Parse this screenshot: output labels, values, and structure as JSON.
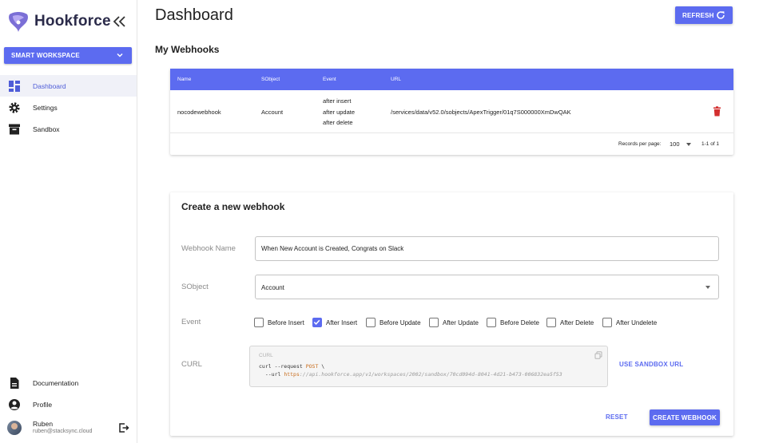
{
  "app": {
    "name": "Hookforce",
    "brand_color": "#5c6bf0"
  },
  "sidebar": {
    "workspace_label": "SMART WORKSPACE",
    "nav": [
      {
        "label": "Dashboard",
        "icon": "dashboard-icon",
        "active": true
      },
      {
        "label": "Settings",
        "icon": "gear-icon",
        "active": false
      },
      {
        "label": "Sandbox",
        "icon": "archive-box-icon",
        "active": false
      }
    ],
    "bottom_nav": [
      {
        "label": "Documentation",
        "icon": "document-icon"
      },
      {
        "label": "Profile",
        "icon": "account-circle-icon"
      }
    ],
    "user": {
      "name": "Ruben",
      "email": "ruben@stacksync.cloud"
    }
  },
  "header": {
    "title": "Dashboard",
    "refresh_label": "REFRESH"
  },
  "webhooks": {
    "section_title": "My Webhooks",
    "columns": [
      "Name",
      "SObject",
      "Event",
      "URL"
    ],
    "rows": [
      {
        "name": "nocodewebhook",
        "sobject": "Account",
        "events": [
          "after insert",
          "after update",
          "after delete"
        ],
        "url": "/services/data/v52.0/sobjects/ApexTrigger/01q7S000000XmDwQAK"
      }
    ],
    "pagination": {
      "records_per_page_label": "Records per page:",
      "records_per_page": "100",
      "range": "1-1 of 1"
    }
  },
  "create": {
    "title": "Create a new webhook",
    "name_label": "Webhook Name",
    "name_value": "When New Account is Created, Congrats on Slack",
    "sobject_label": "SObject",
    "sobject_value": "Account",
    "event_label": "Event",
    "events": [
      {
        "label": "Before Insert",
        "checked": false
      },
      {
        "label": "After Insert",
        "checked": true
      },
      {
        "label": "Before Update",
        "checked": false
      },
      {
        "label": "After Update",
        "checked": false
      },
      {
        "label": "Before Delete",
        "checked": false
      },
      {
        "label": "After Delete",
        "checked": false
      },
      {
        "label": "After Undelete",
        "checked": false
      }
    ],
    "curl_label": "CURL",
    "curl_caption": "CURL",
    "curl": {
      "cmd": "curl --request ",
      "method": "POST",
      "cont": " \\",
      "url_flag": "  --url ",
      "scheme": "https",
      "rest": "://api.hookforce.app/v1/workspaces/2002/sandbox/70cd094d-8041-4d21-b473-006832ea5f53"
    },
    "sandbox_url_label": "USE SANDBOX URL",
    "reset_label": "RESET",
    "submit_label": "CREATE WEBHOOK"
  }
}
